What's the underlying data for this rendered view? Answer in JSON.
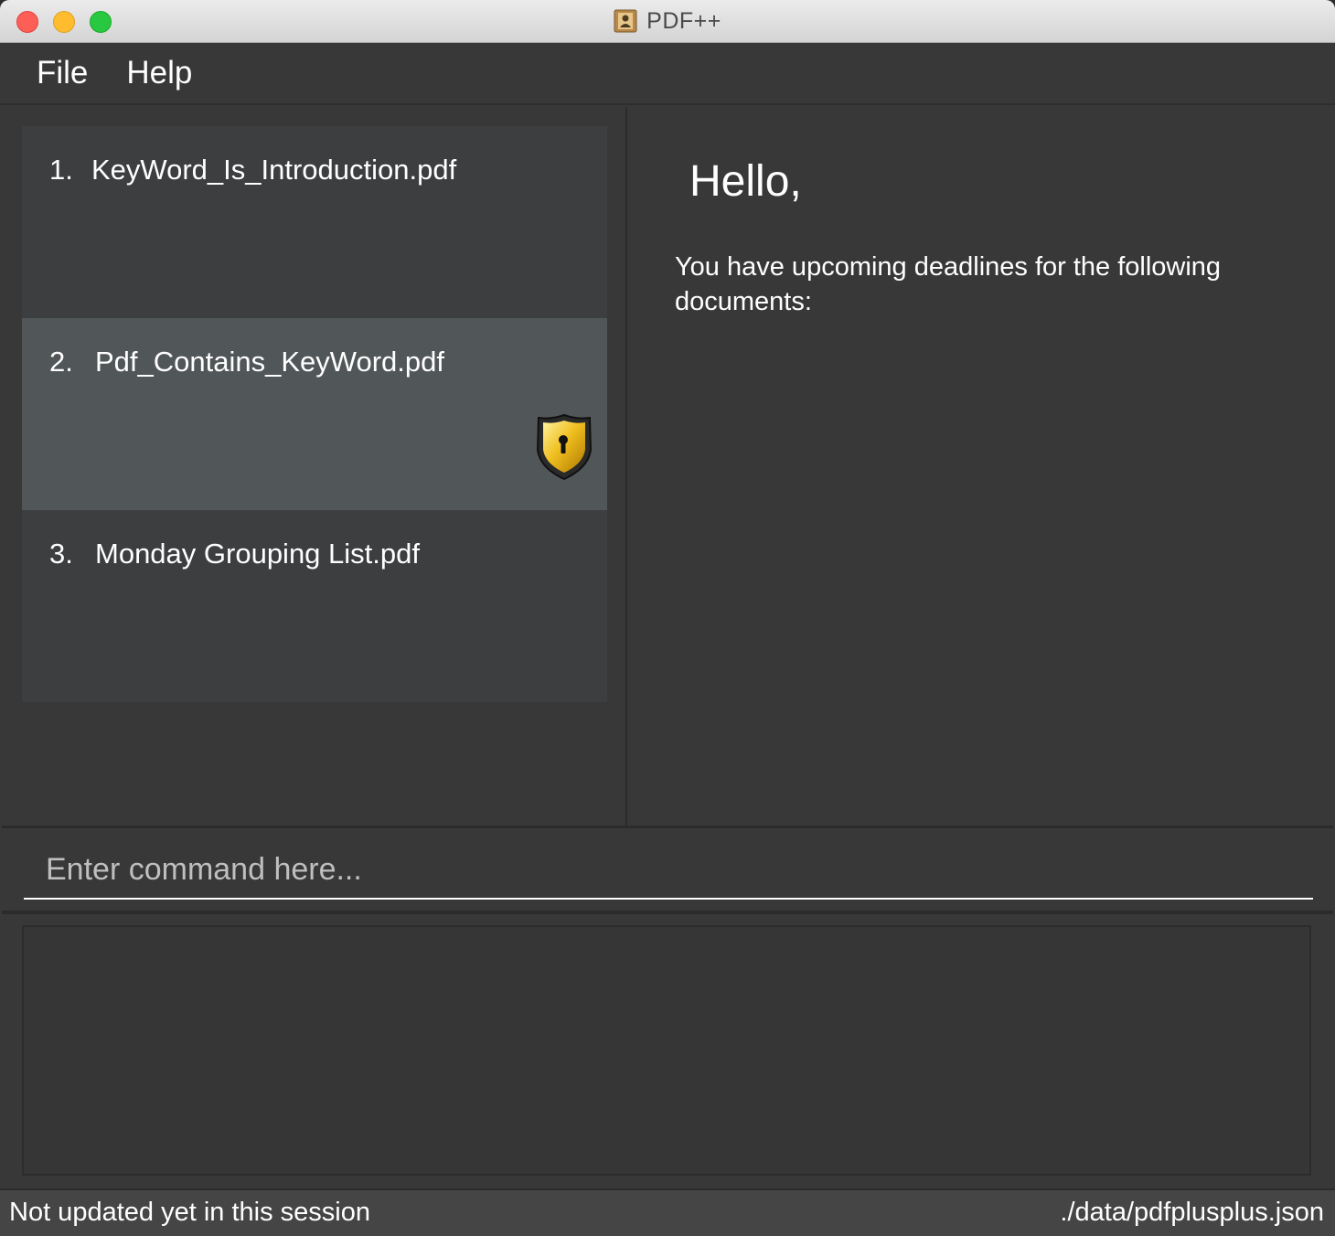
{
  "window": {
    "title": "PDF++"
  },
  "menu": {
    "items": [
      "File",
      "Help"
    ]
  },
  "documents": [
    {
      "index": "1.",
      "name": "KeyWord_Is_Introduction.pdf",
      "locked": false,
      "selected": false
    },
    {
      "index": "2.",
      "name": "Pdf_Contains_KeyWord.pdf",
      "locked": true,
      "selected": true
    },
    {
      "index": "3.",
      "name": "Monday Grouping List.pdf",
      "locked": false,
      "selected": false
    }
  ],
  "detail": {
    "greeting": "Hello,",
    "message": "You have upcoming deadlines for the following documents:"
  },
  "command": {
    "placeholder": "Enter command here...",
    "value": ""
  },
  "result": {
    "text": ""
  },
  "status": {
    "left": "Not updated yet in this session",
    "right": "./data/pdfplusplus.json"
  },
  "colors": {
    "background": "#383838",
    "selected_item": "#515658",
    "list_item": "#3c3e40",
    "text": "#ffffff"
  },
  "icons": {
    "app": "contacts-book-icon",
    "lock": "shield-lock-icon"
  }
}
